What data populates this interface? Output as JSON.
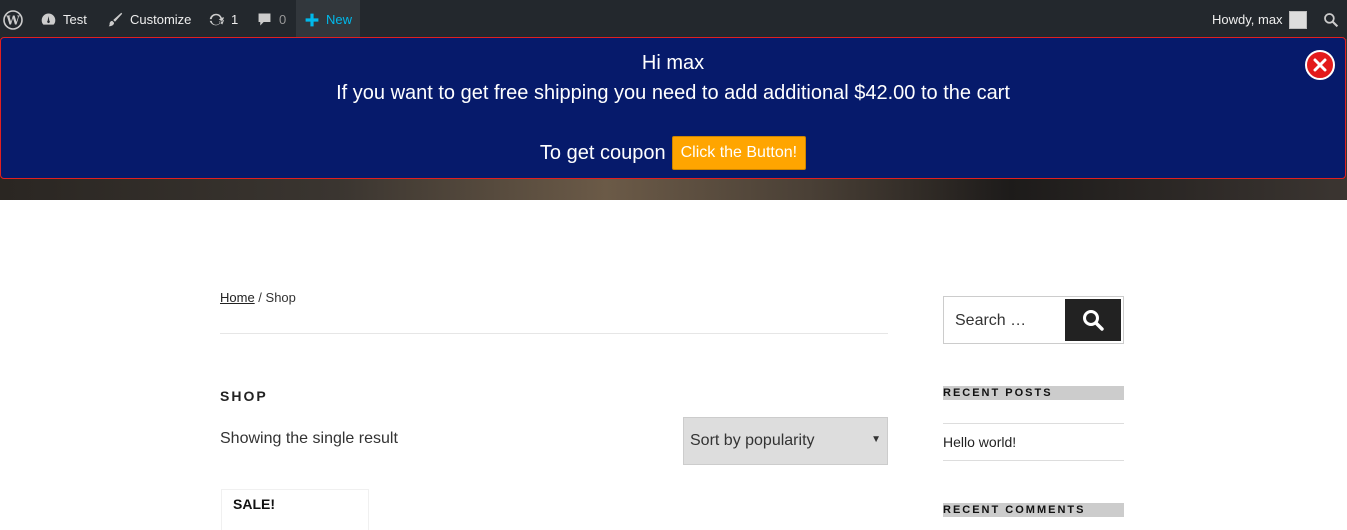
{
  "admin_bar": {
    "site_name": "Test",
    "customize": "Customize",
    "updates_count": "1",
    "comments_count": "0",
    "new_label": "New",
    "greeting": "Howdy, max"
  },
  "notice": {
    "line1": "Hi max",
    "line2": "If you want to get free shipping you need to add additional $42.00 to the cart",
    "coupon_prefix": "To get coupon",
    "coupon_button": "Click the Button!"
  },
  "breadcrumb": {
    "home": "Home",
    "separator": " / ",
    "current": "Shop"
  },
  "shop": {
    "title": "SHOP",
    "result_count": "Showing the single result",
    "sort_selected": "Sort by popularity",
    "sale_badge": "SALE!"
  },
  "sidebar": {
    "search_placeholder": "Search …",
    "recent_posts_title": "RECENT POSTS",
    "recent_posts": [
      "Hello world!"
    ],
    "recent_comments_title": "RECENT COMMENTS"
  },
  "colors": {
    "notice_bg": "#061a6b",
    "coupon_button": "#ffa500",
    "close_button": "#e31b1b",
    "admin_bar": "#23282d"
  }
}
